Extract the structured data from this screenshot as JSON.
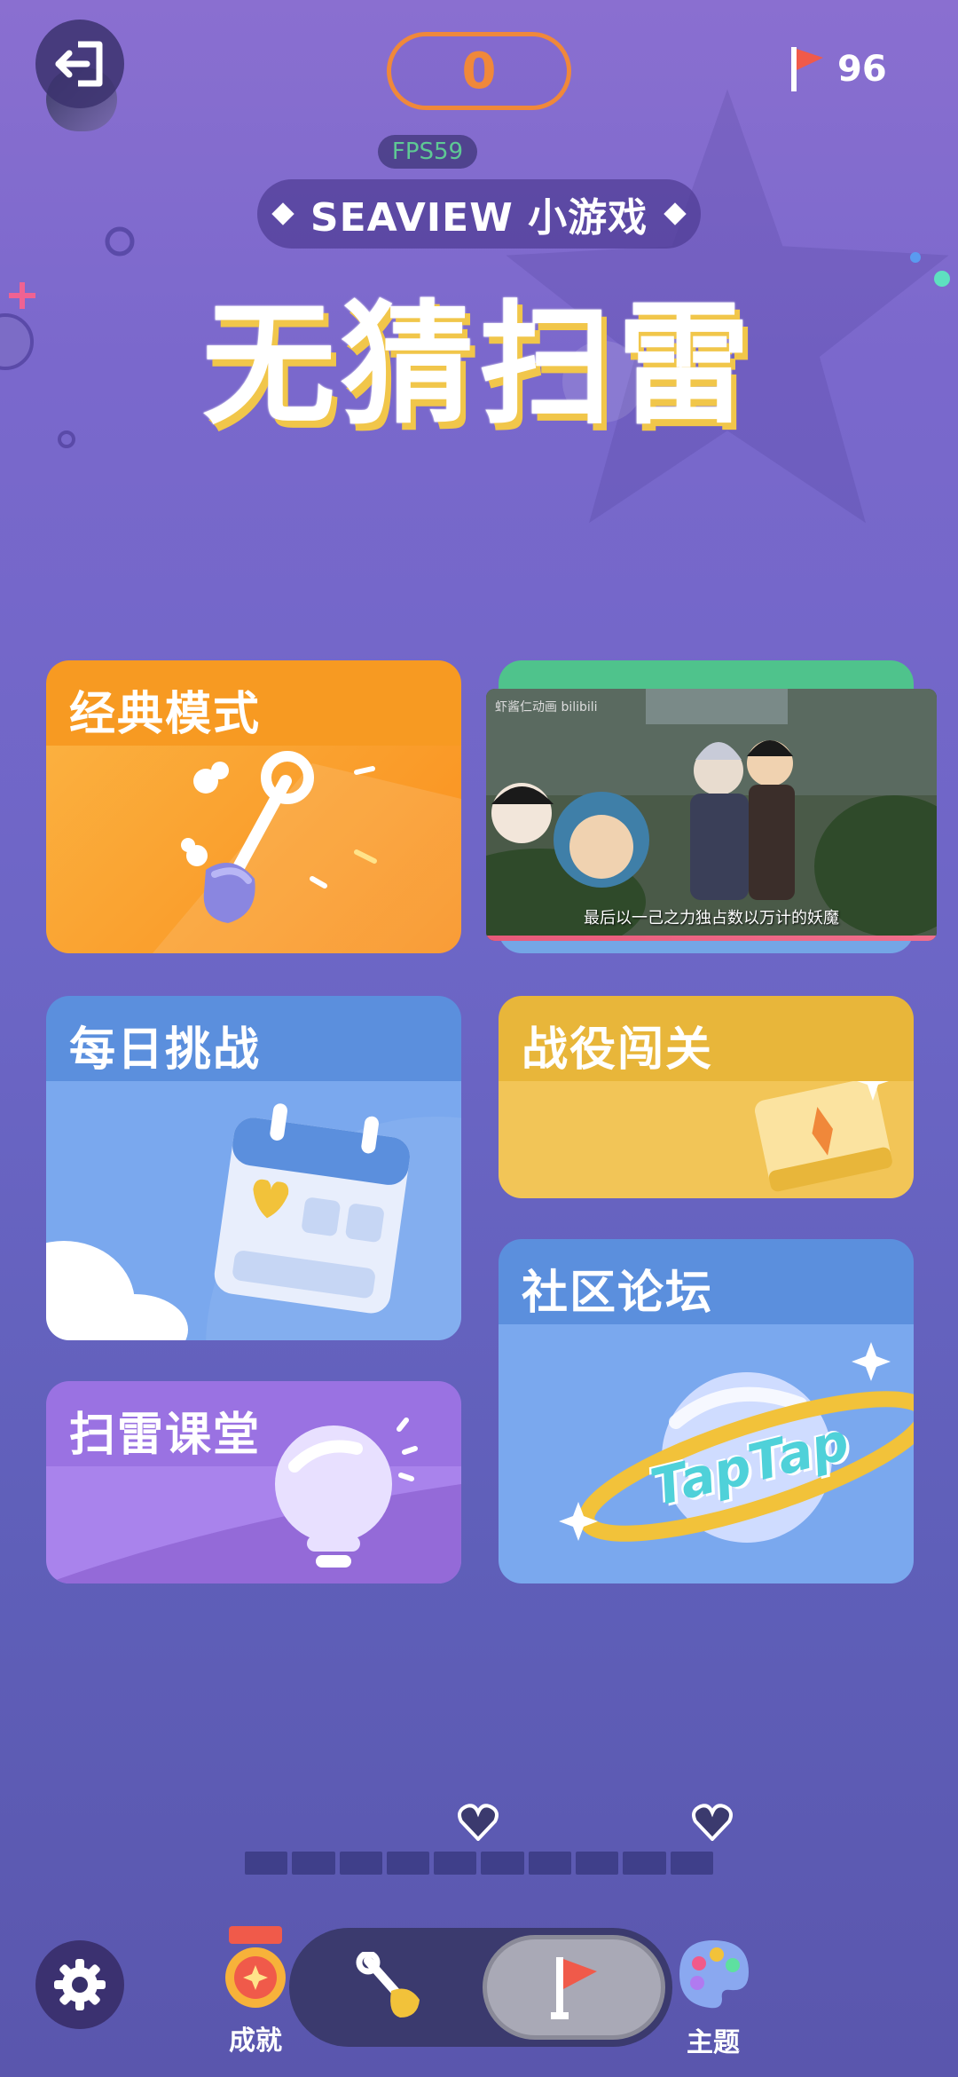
{
  "header": {
    "score": "0",
    "fps": "FPS59",
    "flags_remaining": "96",
    "subtitle": "SEAVIEW 小游戏",
    "title": "无猜扫雷"
  },
  "modes": {
    "classic": "经典模式",
    "daily": "每日挑战",
    "campaign": "战役闯关",
    "community": "社区论坛",
    "classroom": "扫雷课堂"
  },
  "community_logo": "TapTap",
  "video": {
    "watermark": "虾酱仁动画 bilibili",
    "subtitle": "最后以一己之力独占数以万计的妖魔"
  },
  "lives": {
    "hearts": 2,
    "segments_total": 10
  },
  "bottom_nav": {
    "achievements": "成就",
    "theme": "主题",
    "mode_selected": "flag"
  },
  "colors": {
    "accent_orange": "#f0883a",
    "title_shadow": "#f1c64a",
    "fps_green": "#5ec994"
  }
}
